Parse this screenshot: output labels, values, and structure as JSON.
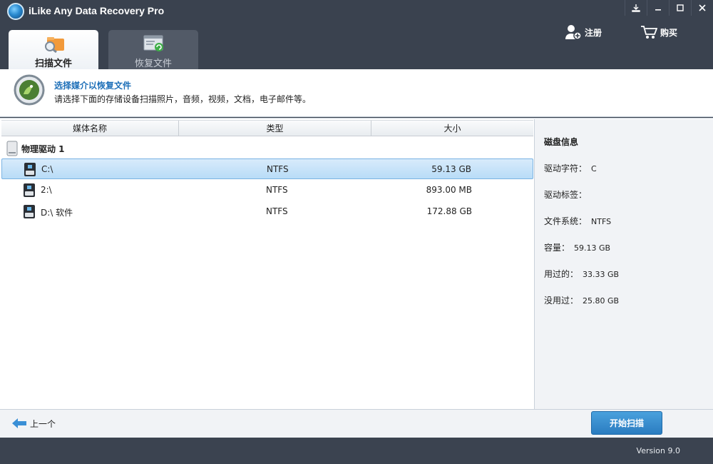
{
  "app": {
    "title": "iLike Any Data Recovery Pro"
  },
  "window_controls": {
    "download": "download-icon",
    "minimize": "minimize-icon",
    "maximize": "maximize-icon",
    "close": "close-icon"
  },
  "tabs": [
    {
      "label": "扫描文件",
      "active": true
    },
    {
      "label": "恢复文件",
      "active": false
    }
  ],
  "header_actions": {
    "register": "注册",
    "buy": "购买"
  },
  "info": {
    "title": "选择媒介以恢复文件",
    "description": "请选择下面的存储设备扫描照片，音频，视频，文档，电子邮件等。"
  },
  "table": {
    "columns": [
      "媒体名称",
      "类型",
      "大小"
    ],
    "group_label": "物理驱动 1",
    "rows": [
      {
        "name": "C:\\",
        "type": "NTFS",
        "size": "59.13 GB",
        "selected": true
      },
      {
        "name": "2:\\",
        "type": "NTFS",
        "size": "893.00 MB",
        "selected": false
      },
      {
        "name": "D:\\ 软件",
        "type": "NTFS",
        "size": "172.88 GB",
        "selected": false
      }
    ]
  },
  "disk_info": {
    "title": "磁盘信息",
    "drive_letter": {
      "label": "驱动字符：",
      "value": "C"
    },
    "drive_label": {
      "label": "驱动标签：",
      "value": ""
    },
    "file_system": {
      "label": "文件系统：",
      "value": "NTFS"
    },
    "capacity": {
      "label": "容量：",
      "value": "59.13 GB"
    },
    "used": {
      "label": "用过的：",
      "value": "33.33 GB"
    },
    "unused": {
      "label": "没用过：",
      "value": "25.80 GB"
    }
  },
  "footer": {
    "back": "上一个",
    "start_scan": "开始扫描"
  },
  "status": {
    "version": "Version 9.0"
  },
  "colors": {
    "accent": "#2a7cc0",
    "header_bg": "#3a424f",
    "title_text": "#1d6fb8",
    "selection": "#b8dcf7"
  }
}
